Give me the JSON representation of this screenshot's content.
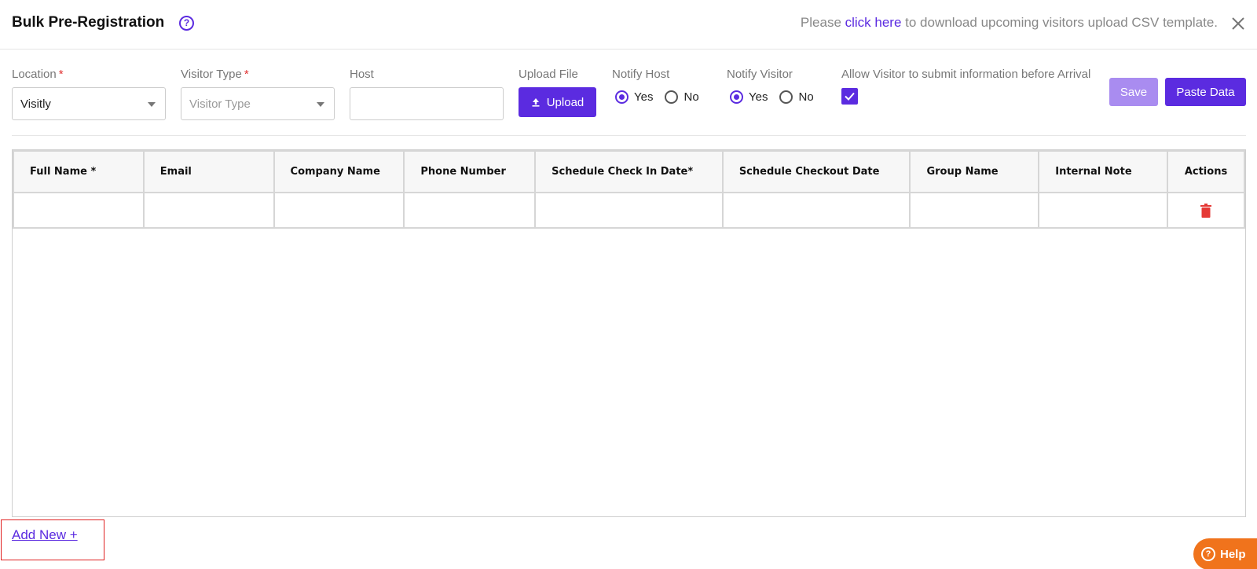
{
  "header": {
    "title": "Bulk Pre-Registration",
    "help_icon": "question-circle-icon",
    "csv_prefix": "Please ",
    "csv_link": "click here",
    "csv_suffix": " to download upcoming visitors upload CSV template.",
    "close_icon": "close-icon"
  },
  "form": {
    "location": {
      "label": "Location",
      "required": "*",
      "value": "Visitly"
    },
    "visitor_type": {
      "label": "Visitor Type",
      "required": "*",
      "placeholder": "Visitor Type"
    },
    "host": {
      "label": "Host",
      "value": ""
    },
    "upload": {
      "label": "Upload File",
      "button": "Upload",
      "icon": "upload-icon"
    },
    "notify_host": {
      "label": "Notify Host",
      "options": [
        "Yes",
        "No"
      ],
      "selected": "Yes"
    },
    "notify_visitor": {
      "label": "Notify Visitor",
      "options": [
        "Yes",
        "No"
      ],
      "selected": "Yes"
    },
    "allow_visitor": {
      "label": "Allow Visitor to submit information before Arrival",
      "checked": true
    },
    "save_label": "Save",
    "paste_label": "Paste Data"
  },
  "table": {
    "columns": [
      "Full Name *",
      "Email",
      "Company Name",
      "Phone Number",
      "Schedule Check In Date*",
      "Schedule Checkout Date",
      "Group Name",
      "Internal Note",
      "Actions"
    ],
    "rows": [
      [
        "",
        "",
        "",
        "",
        "",
        "",
        "",
        ""
      ]
    ],
    "delete_icon": "trash-icon"
  },
  "footer": {
    "add_new": "Add New +",
    "help_label": "Help"
  },
  "colors": {
    "accent": "#5b2be0",
    "save_disabled": "#a98cf0",
    "help": "#f0731c",
    "danger": "#e03030"
  }
}
